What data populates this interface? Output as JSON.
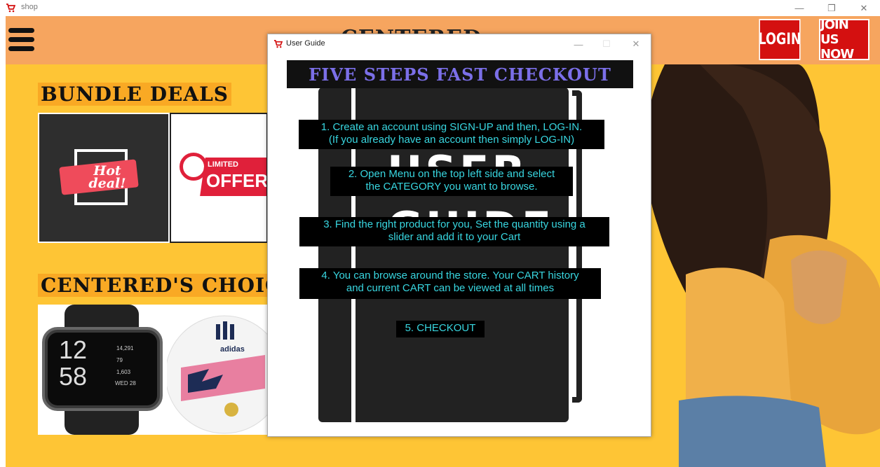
{
  "window": {
    "title": "shop"
  },
  "header": {
    "brand": "CENTERED",
    "login_label": "LOGIN",
    "join_label": "JOIN US NOW"
  },
  "sections": {
    "bundle_title": "BUNDLE DEALS",
    "bundle_cards": [
      {
        "text": "Hot deal!"
      },
      {
        "text_top": "LIMITED",
        "text_bottom": "OFFER"
      }
    ],
    "choice_title": "CENTERED'S CHOICE",
    "watch": {
      "time_h": "12",
      "time_m": "58",
      "stat1": "14,291",
      "stat2": "79",
      "stat3": "1,603",
      "date": "WED 28"
    },
    "ball": {
      "brand": "adidas"
    }
  },
  "dialog": {
    "title": "User Guide",
    "header": "FIVE STEPS FAST CHECKOUT",
    "bg_words": [
      "USER",
      "GUIDE"
    ],
    "steps": [
      "1. Create an account using SIGN-UP and then, LOG-IN.\n(If you already have an account then simply LOG-IN)",
      "2. Open Menu on the top left side and select\nthe CATEGORY you want to browse.",
      "3. Find the right product for you, Set the quantity using a\nslider and add it to your Cart",
      "4. You can browse around the store. Your CART history\nand current CART can be viewed at all times",
      "5. CHECKOUT"
    ]
  },
  "colors": {
    "app_bg": "#fec535",
    "topbar": "#f6a55f",
    "button_red": "#d41010",
    "guide_header_text": "#7b6fe8",
    "step_text": "#38d6e0"
  },
  "icons": [
    "cart-icon",
    "minimize-icon",
    "maximize-icon",
    "close-icon",
    "menu-icon"
  ]
}
